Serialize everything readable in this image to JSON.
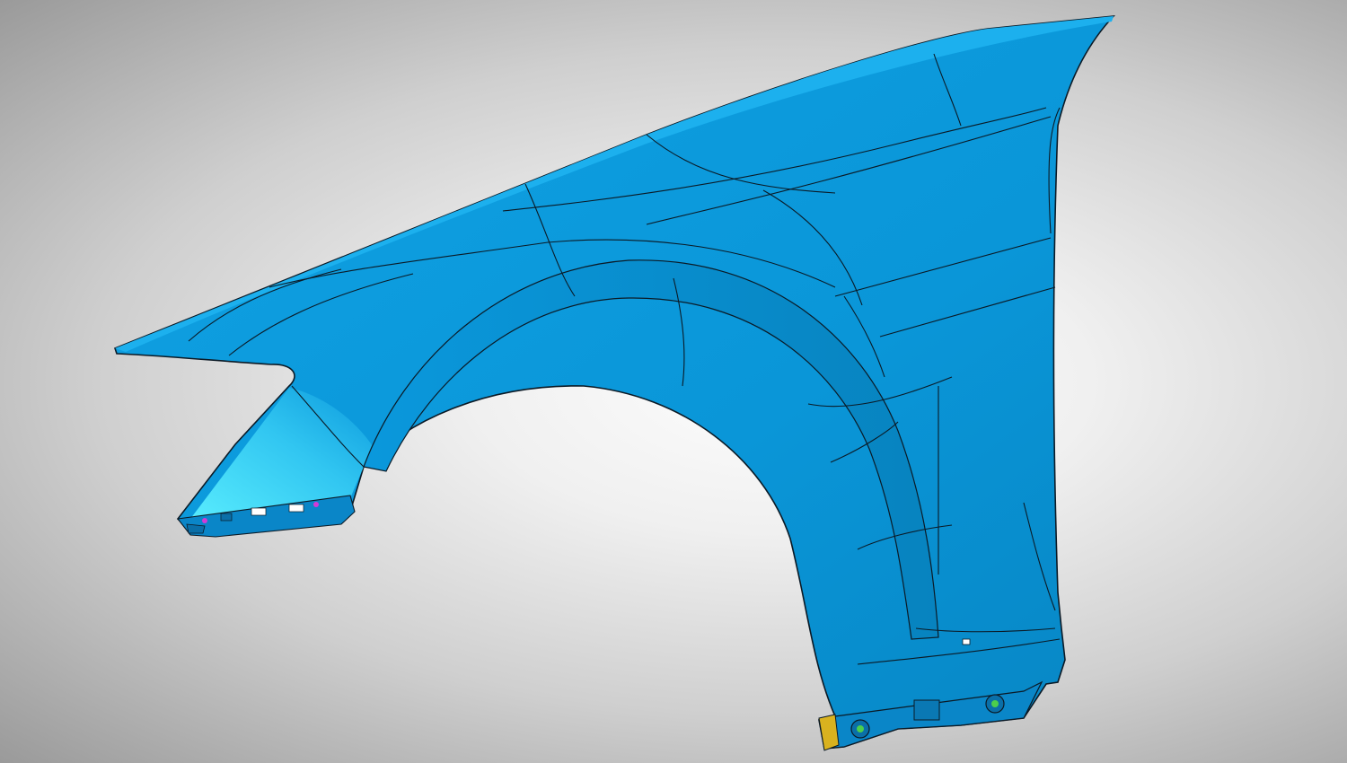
{
  "scene": {
    "subject": "fender-cad-model",
    "colors": {
      "background_center": "#f4f4f4",
      "background_edge": "#9a9a9a",
      "panel_base": "#0a98dc",
      "panel_highlight": "#4fe6ff",
      "panel_shadow": "#067fb8",
      "edge_lines": "#0b1a26",
      "bracket": "#0a86c8",
      "bracket_tab": "#d9b21f",
      "marker_magenta": "#d23ad6",
      "marker_green": "#4ccf4c"
    }
  }
}
